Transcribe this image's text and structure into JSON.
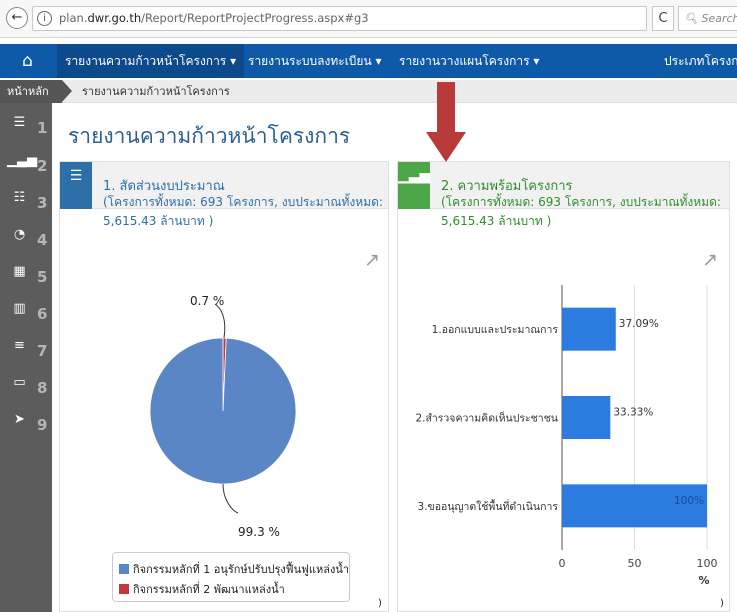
{
  "browser": {
    "url_prefix": "plan.",
    "url_domain": "dwr.go.th",
    "url_path": "/Report/ReportProjectProgress.aspx#g3",
    "search_placeholder": "Search",
    "back": "←",
    "info": "i",
    "refresh": "C"
  },
  "nav": {
    "items": [
      "รายงานความก้าวหน้าโครงการ ▾",
      "รายงานระบบลงทะเบียน ▾",
      "รายงานวางแผนโครงการ ▾",
      "ประเภทโครงก"
    ]
  },
  "breadcrumb": {
    "home": "หน้าหลัก",
    "current": "รายงานความก้าวหน้าโครงการ"
  },
  "sidebar": {
    "numbers": [
      "1",
      "2",
      "3",
      "4",
      "5",
      "6",
      "7",
      "8",
      "9"
    ],
    "colors": [
      "#2f6fa9",
      "#4ca748",
      "#1b9cd8",
      "#d8a340",
      "#8a58a3",
      "#c7414c",
      "#4f4f4f",
      "#8a2d6d",
      "#3c78b4"
    ]
  },
  "page": {
    "title": "รายงานความก้าวหน้าโครงการ"
  },
  "card1": {
    "line1": "1. สัดส่วนงบประมาณ",
    "line2": "(โครงการทั้งหมด: 693 โครงการ, งบประมาณทั้งหมด:",
    "line3": "5,615.43 ล้านบาท )",
    "color": "#2f6fa9"
  },
  "card2": {
    "line1": "2. ความพร้อมโครงการ",
    "line2": "(โครงการทั้งหมด: 693 โครงการ, งบประมาณทั้งหมด:",
    "line3": "5,615.43 ล้านบาท )",
    "color": "#4ca748"
  },
  "pie": {
    "label_small": "0.7 %",
    "label_big": "99.3 %",
    "legend": [
      "กิจกรรมหลักที่ 1 อนุรักษ์ปรับปรุงฟื้นฟูแหล่งน้ำ",
      "กิจกรรมหลักที่ 2 พัฒนาแหล่งน้ำ"
    ],
    "footnote": ")"
  },
  "bar": {
    "unit": "%",
    "footnote": ")"
  },
  "chart_data": [
    {
      "type": "pie",
      "categories": [
        "กิจกรรมหลักที่ 1 อนุรักษ์ปรับปรุงฟื้นฟูแหล่งน้ำ",
        "กิจกรรมหลักที่ 2 พัฒนาแหล่งน้ำ"
      ],
      "values": [
        99.3,
        0.7
      ],
      "colors": [
        "#5b86c6",
        "#c0393b"
      ],
      "labels": [
        "99.3 %",
        "0.7 %"
      ]
    },
    {
      "type": "bar",
      "orientation": "horizontal",
      "categories": [
        "1.ออกแบบและประมาณการ",
        "2.สำรวจความคิดเห็นประชาชน",
        "3.ขออนุญาตใช้พื้นที่ดำเนินการ"
      ],
      "values": [
        37.09,
        33.33,
        100
      ],
      "labels": [
        "37.09%",
        "33.33%",
        "100%"
      ],
      "xlim": [
        0,
        100
      ],
      "xticks": [
        0,
        50,
        100
      ],
      "xlabel": "%",
      "color": "#2b7be0"
    }
  ]
}
